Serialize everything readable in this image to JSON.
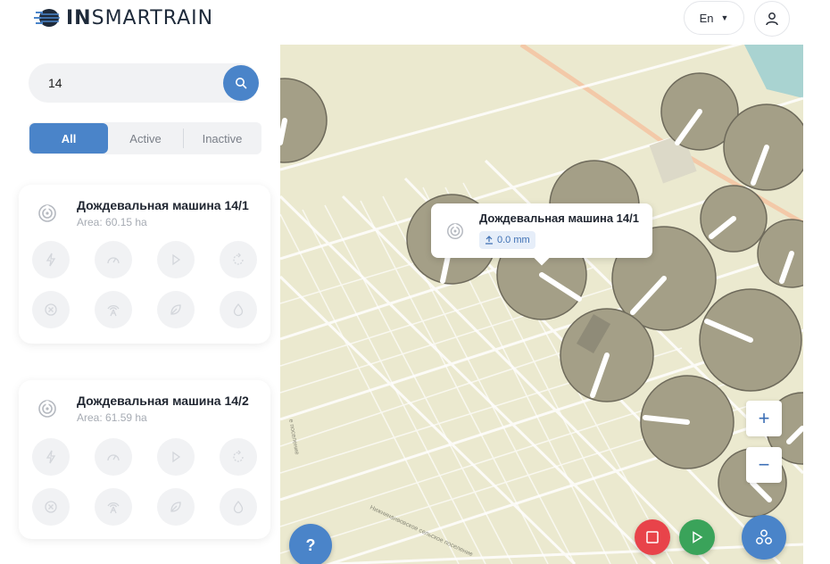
{
  "header": {
    "logo_text_bold": "IN",
    "logo_text_light": "SMARTRAIN",
    "language": "En"
  },
  "sidebar": {
    "search": {
      "value": "14",
      "placeholder": ""
    },
    "filters": {
      "all": "All",
      "active": "Active",
      "inactive": "Inactive"
    },
    "cards": [
      {
        "title": "Дождевальная машина 14/1",
        "area": "Area: 60.15 ha"
      },
      {
        "title": "Дождевальная машина 14/2",
        "area": "Area: 61.59 ha"
      }
    ]
  },
  "map": {
    "popup": {
      "title": "Дождевальная машина 14/1",
      "badge": "0.0 mm"
    },
    "zoom_in": "+",
    "zoom_out": "−",
    "help": "?"
  },
  "colors": {
    "accent": "#4a84c9",
    "stop": "#e8434a",
    "play": "#3aa35a",
    "map_bg": "#ebe9cf",
    "pivot": "#a49f87"
  }
}
